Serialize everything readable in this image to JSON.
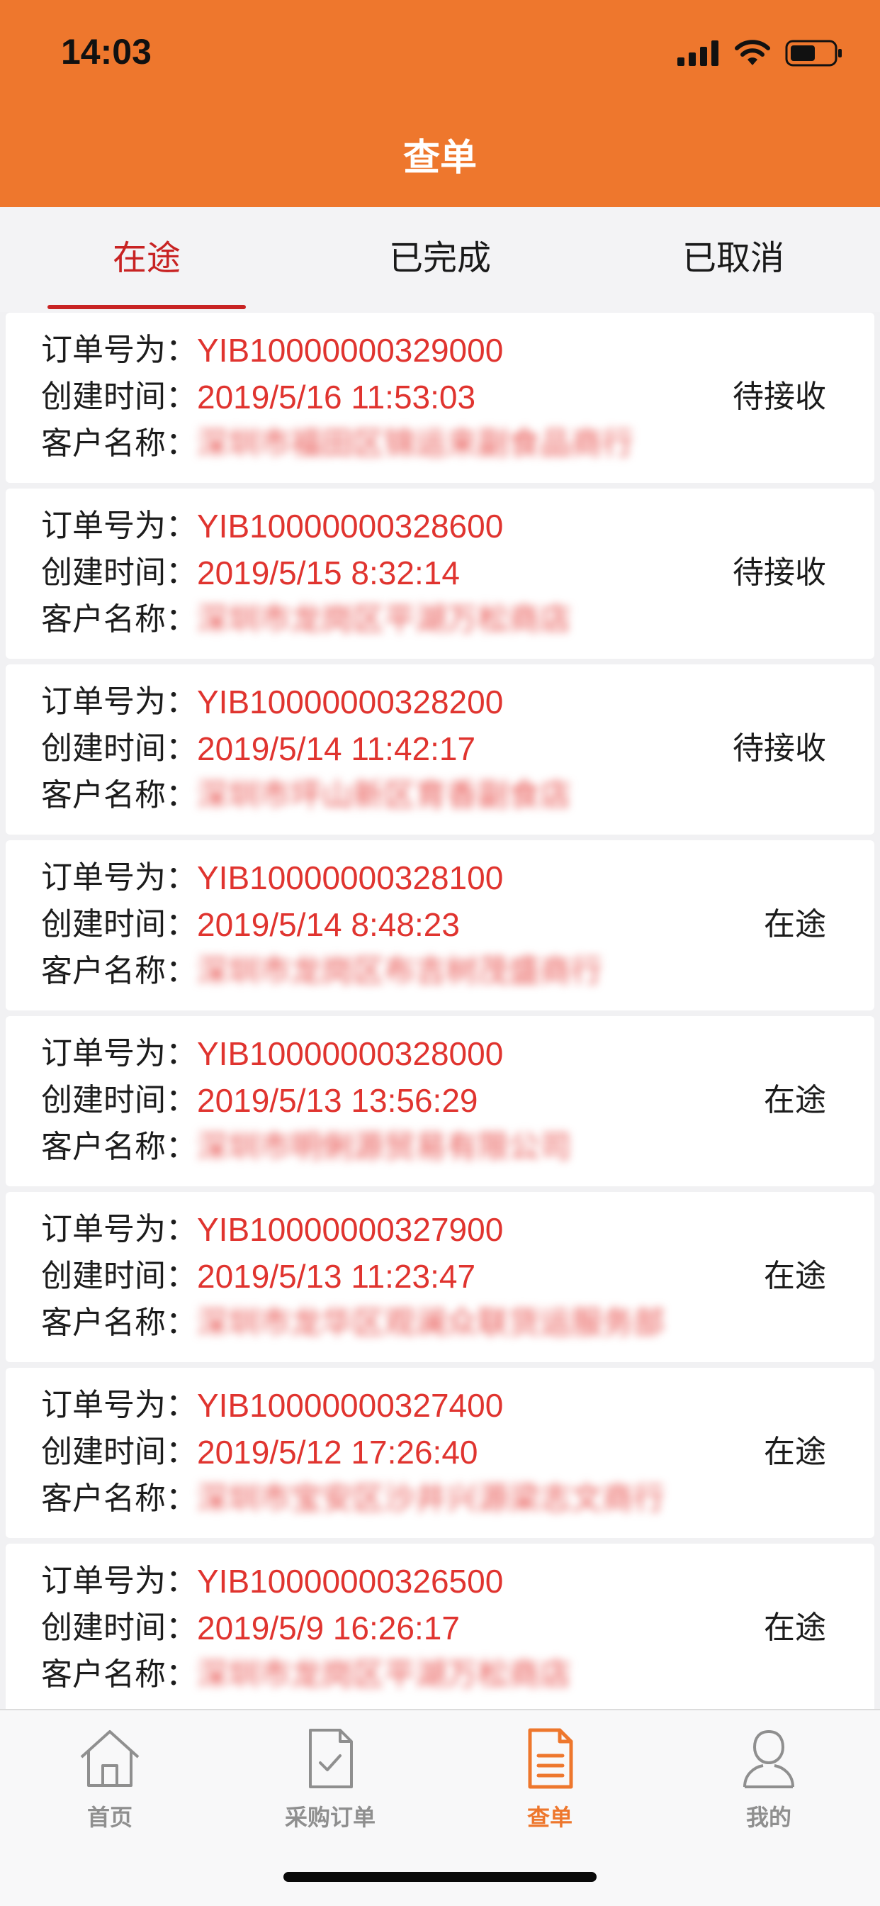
{
  "status_bar": {
    "time": "14:03"
  },
  "header": {
    "title": "查单"
  },
  "tabs": [
    {
      "label": "在途",
      "active": true
    },
    {
      "label": "已完成",
      "active": false
    },
    {
      "label": "已取消",
      "active": false
    }
  ],
  "labels": {
    "order_no": "订单号为：",
    "created": "创建时间：",
    "customer": "客户名称："
  },
  "orders": [
    {
      "order_no": "YIB10000000329000",
      "created": "2019/5/16 11:53:03",
      "customer": "深圳市福田区锦运来副食品商行",
      "status": "待接收"
    },
    {
      "order_no": "YIB10000000328600",
      "created": "2019/5/15 8:32:14",
      "customer": "深圳市龙岗区平湖万松商店",
      "status": "待接收"
    },
    {
      "order_no": "YIB10000000328200",
      "created": "2019/5/14 11:42:17",
      "customer": "深圳市坪山新区育香副食店",
      "status": "待接收"
    },
    {
      "order_no": "YIB10000000328100",
      "created": "2019/5/14 8:48:23",
      "customer": "深圳市龙岗区布吉树茂盛商行",
      "status": "在途"
    },
    {
      "order_no": "YIB10000000328000",
      "created": "2019/5/13 13:56:29",
      "customer": "深圳市明俐源贸易有限公司",
      "status": "在途"
    },
    {
      "order_no": "YIB10000000327900",
      "created": "2019/5/13 11:23:47",
      "customer": "深圳市龙华区观澜众联货运服务部",
      "status": "在途"
    },
    {
      "order_no": "YIB10000000327400",
      "created": "2019/5/12 17:26:40",
      "customer": "深圳市宝安区沙井兴源梁志文商行",
      "status": "在途"
    },
    {
      "order_no": "YIB10000000326500",
      "created": "2019/5/9 16:26:17",
      "customer": "深圳市龙岗区平湖万松商店",
      "status": "在途"
    }
  ],
  "tabbar": [
    {
      "label": "首页",
      "icon": "home-icon",
      "active": false
    },
    {
      "label": "采购订单",
      "icon": "document-check-icon",
      "active": false
    },
    {
      "label": "查单",
      "icon": "document-list-icon",
      "active": true
    },
    {
      "label": "我的",
      "icon": "user-icon",
      "active": false
    }
  ],
  "colors": {
    "brand": "#ee772d",
    "accent_red": "#c82323",
    "value_red": "#e0342f"
  }
}
